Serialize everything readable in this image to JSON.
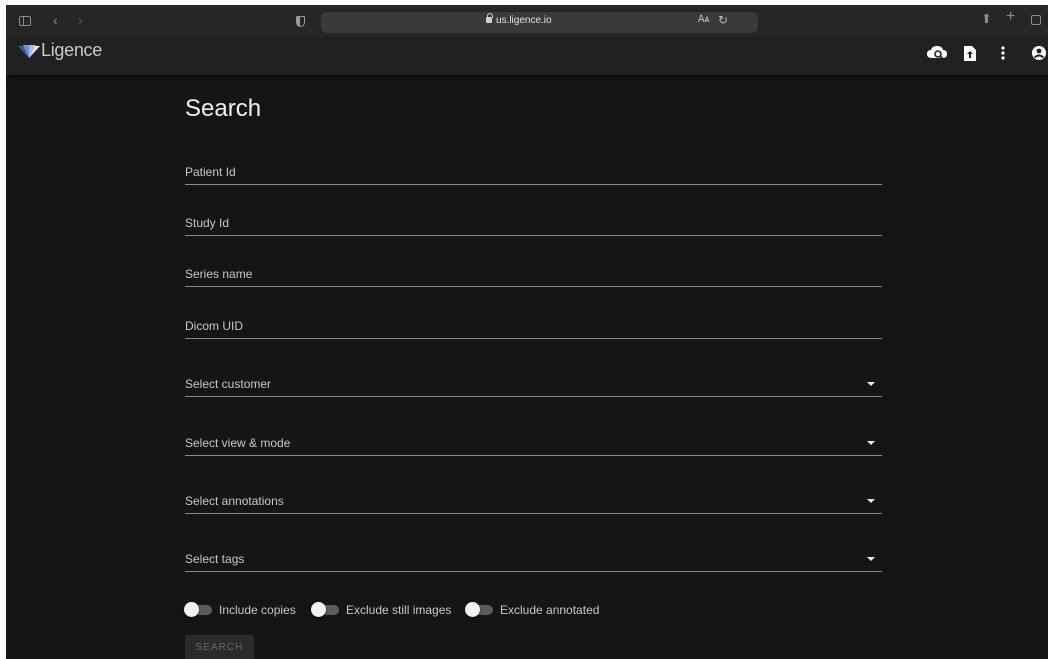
{
  "browser": {
    "url": "us.ligence.io"
  },
  "app": {
    "brand": "Ligence",
    "header_icons": [
      "cloud-search-icon",
      "upload-file-icon",
      "more-vert-icon",
      "account-icon"
    ]
  },
  "search": {
    "title": "Search",
    "fields": {
      "patient_id": "Patient Id",
      "study_id": "Study Id",
      "series_name": "Series name",
      "dicom_uid": "Dicom UID"
    },
    "selects": {
      "customer": "Select customer",
      "view_mode": "Select view & mode",
      "annotations": "Select annotations",
      "tags": "Select tags"
    },
    "toggles": {
      "include_copies": "Include copies",
      "exclude_still_images": "Exclude still images",
      "exclude_annotated": "Exclude annotated"
    },
    "button_label": "SEARCH"
  },
  "colors": {
    "page_background": "#151515",
    "header_background": "#212121",
    "field_underline": "#8a8a8a"
  }
}
